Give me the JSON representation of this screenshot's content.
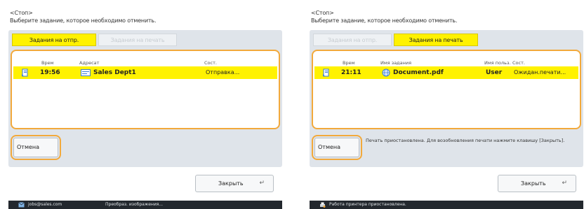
{
  "left": {
    "header": {
      "line1": "<Стоп>",
      "line2": "Выберите задание, которое необходимо отменить."
    },
    "tabs": [
      {
        "label": "Задания на отпр.",
        "active": true
      },
      {
        "label": "Задания на печать",
        "active": false
      }
    ],
    "columns": {
      "time": "Врем",
      "address": "Адресат",
      "status": "Сост."
    },
    "rows": [
      {
        "time": "19:56",
        "address": "Sales Dept1",
        "status": "Отправка..."
      }
    ],
    "cancel_label": "Отмена",
    "close_label": "Закрыть",
    "status_bar": {
      "left": "jobs@sales.com",
      "right": "Преобраз. изображения..."
    }
  },
  "right": {
    "header": {
      "line1": "<Стоп>",
      "line2": "Выберите задание, которое необходимо отменить."
    },
    "tabs": [
      {
        "label": "Задания на отпр.",
        "active": false
      },
      {
        "label": "Задания на печать",
        "active": true
      }
    ],
    "columns": {
      "time": "Врем",
      "job_name": "Имя задания",
      "user_name": "Имя польз.",
      "status": "Сост."
    },
    "rows": [
      {
        "time": "21:11",
        "job_name": "Document.pdf",
        "user_name": "User",
        "status": "Ожидан.печати..."
      }
    ],
    "cancel_label": "Отмена",
    "pause_message": "Печать приостановлена. Для возобновления печати нажмите клавишу [Закрыть].",
    "close_label": "Закрыть",
    "status_bar": {
      "text": "Работа принтера приостановлена."
    }
  },
  "colors": {
    "highlight": "#fff200",
    "focus_ring": "#f2a93b",
    "panel": "#dfe4ea",
    "status_bar": "#23282e"
  }
}
